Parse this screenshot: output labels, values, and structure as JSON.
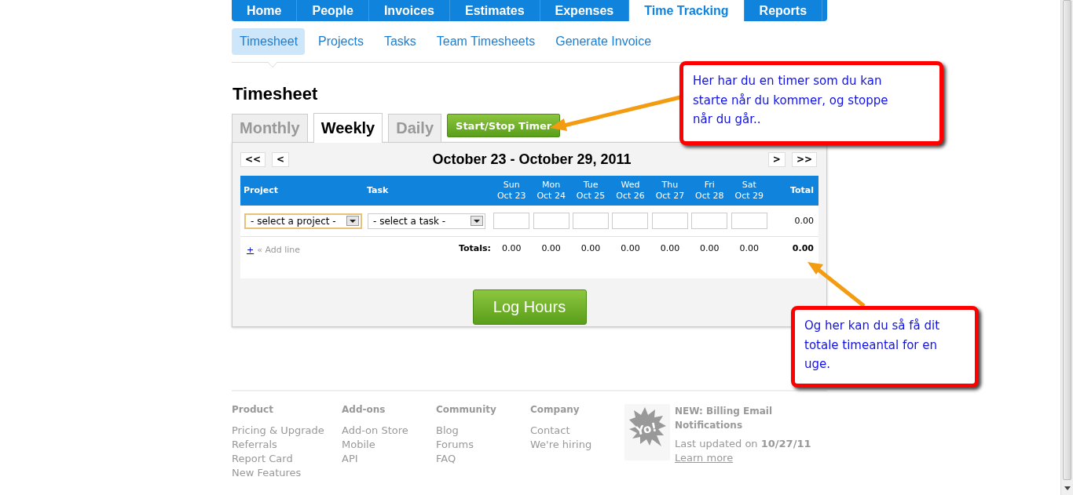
{
  "nav": [
    {
      "label": "Home",
      "selected": false
    },
    {
      "label": "People",
      "selected": false
    },
    {
      "label": "Invoices",
      "selected": false
    },
    {
      "label": "Estimates",
      "selected": false
    },
    {
      "label": "Expenses",
      "selected": false
    },
    {
      "label": "Time Tracking",
      "selected": true
    },
    {
      "label": "Reports",
      "selected": false
    }
  ],
  "subnav": [
    {
      "label": "Timesheet",
      "selected": true
    },
    {
      "label": "Projects",
      "selected": false
    },
    {
      "label": "Tasks",
      "selected": false
    },
    {
      "label": "Team Timesheets",
      "selected": false
    },
    {
      "label": "Generate Invoice",
      "selected": false
    }
  ],
  "page_title": "Timesheet",
  "view_tabs": [
    {
      "label": "Monthly",
      "selected": false
    },
    {
      "label": "Weekly",
      "selected": true
    },
    {
      "label": "Daily",
      "selected": false
    }
  ],
  "timer_button": "Start/Stop Timer",
  "date_nav": {
    "prev_far": "<<",
    "prev": "<",
    "title": "October 23 - October 29, 2011",
    "next": ">",
    "next_far": ">>"
  },
  "table": {
    "project_header": "Project",
    "task_header": "Task",
    "total_header": "Total",
    "days": [
      {
        "day": "Sun",
        "date": "Oct 23"
      },
      {
        "day": "Mon",
        "date": "Oct 24"
      },
      {
        "day": "Tue",
        "date": "Oct 25"
      },
      {
        "day": "Wed",
        "date": "Oct 26"
      },
      {
        "day": "Thu",
        "date": "Oct 27"
      },
      {
        "day": "Fri",
        "date": "Oct 28"
      },
      {
        "day": "Sat",
        "date": "Oct 29"
      }
    ],
    "row": {
      "project_select": {
        "value": "- select a project -",
        "focused": true
      },
      "task_select": {
        "value": "- select a task -",
        "focused": false
      },
      "total": "0.00"
    },
    "add_line": {
      "plus": "+",
      "label": "« Add line"
    },
    "totals_label": "Totals:",
    "totals": [
      "0.00",
      "0.00",
      "0.00",
      "0.00",
      "0.00",
      "0.00",
      "0.00"
    ],
    "grand_total": "0.00"
  },
  "log_button": "Log Hours",
  "footer": {
    "columns": [
      {
        "heading": "Product",
        "links": [
          "Pricing & Upgrade",
          "Referrals",
          "Report Card",
          "New Features"
        ]
      },
      {
        "heading": "Add-ons",
        "links": [
          "Add-on Store",
          "Mobile",
          "API"
        ]
      },
      {
        "heading": "Community",
        "links": [
          "Blog",
          "Forums",
          "FAQ"
        ]
      },
      {
        "heading": "Company",
        "links": [
          "Contact",
          "We're hiring"
        ]
      }
    ],
    "news": {
      "badge": "Yo!",
      "title": "NEW: Billing Email Notifications",
      "updated": "Last updated on **10/27/11**",
      "link": "Learn more"
    }
  },
  "callouts": [
    {
      "text": "Her har du en timer som du kan starte når du kommer, og stoppe når du går.."
    },
    {
      "text": "Og her kan du så få dit totale timeantal for en uge."
    }
  ]
}
